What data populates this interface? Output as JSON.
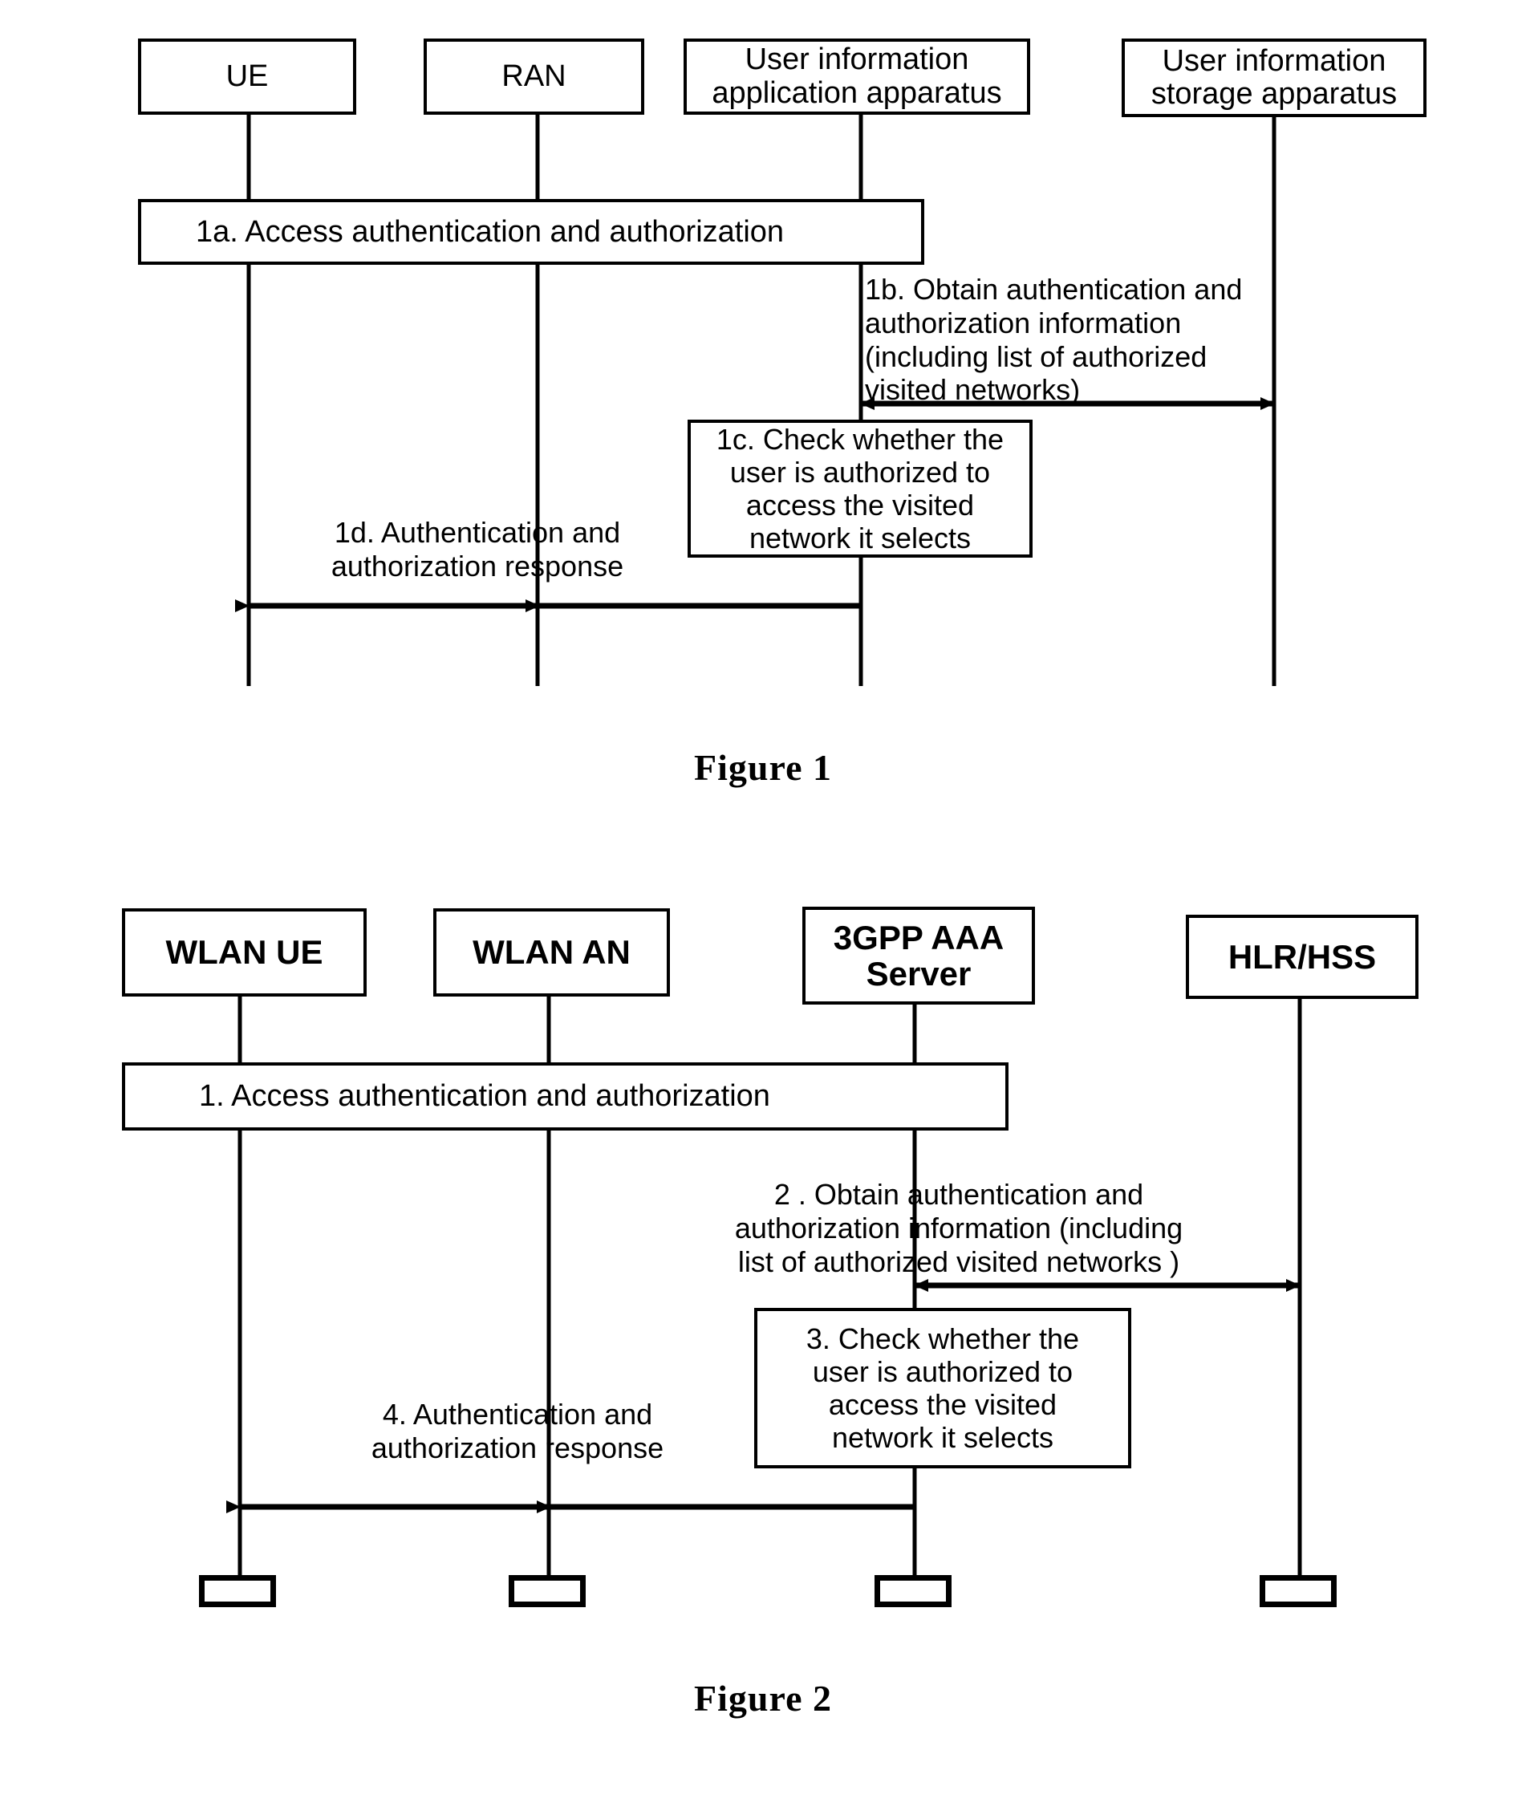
{
  "document": {
    "type": "patent-figure-sheet",
    "figures": [
      {
        "id": "figure-1",
        "caption": "Figure 1",
        "lifelines": [
          {
            "id": "ue",
            "label": "UE"
          },
          {
            "id": "ran",
            "label": "RAN"
          },
          {
            "id": "user-info-app",
            "label": "User information\napplication apparatus"
          },
          {
            "id": "user-info-storage",
            "label": "User  information\nstorage apparatus"
          }
        ],
        "steps": [
          {
            "id": "step-1a",
            "kind": "activity-bar",
            "label": "1a. Access authentication and authorization"
          },
          {
            "id": "step-1b",
            "kind": "message-bidirectional",
            "label": "1b. Obtain authentication and\nauthorization information\n(including list of authorized\nvisited networks)"
          },
          {
            "id": "step-1c",
            "kind": "note",
            "label": "1c. Check whether the\nuser is authorized to\naccess the visited\nnetwork it selects"
          },
          {
            "id": "step-1d",
            "kind": "message-left",
            "label": "1d. Authentication and\nauthorization response"
          }
        ]
      },
      {
        "id": "figure-2",
        "caption": "Figure 2",
        "lifelines": [
          {
            "id": "wlan-ue",
            "label": "WLAN UE"
          },
          {
            "id": "wlan-an",
            "label": "WLAN AN"
          },
          {
            "id": "aaa-server",
            "label": "3GPP AAA\nServer"
          },
          {
            "id": "hlr-hss",
            "label": "HLR/HSS"
          }
        ],
        "steps": [
          {
            "id": "step-1",
            "kind": "activity-bar",
            "label": "1. Access authentication and authorization"
          },
          {
            "id": "step-2",
            "kind": "message-bidirectional",
            "label": "2 . Obtain authentication and\nauthorization information   (including\nlist of authorized visited networks  )"
          },
          {
            "id": "step-3",
            "kind": "note",
            "label": "3. Check whether the\nuser is authorized to\naccess the visited\nnetwork it selects"
          },
          {
            "id": "step-4",
            "kind": "message-left",
            "label": "4.  Authentication and\nauthorization response"
          }
        ]
      }
    ],
    "colors": {
      "ink": "#000000",
      "paper": "#ffffff"
    }
  }
}
